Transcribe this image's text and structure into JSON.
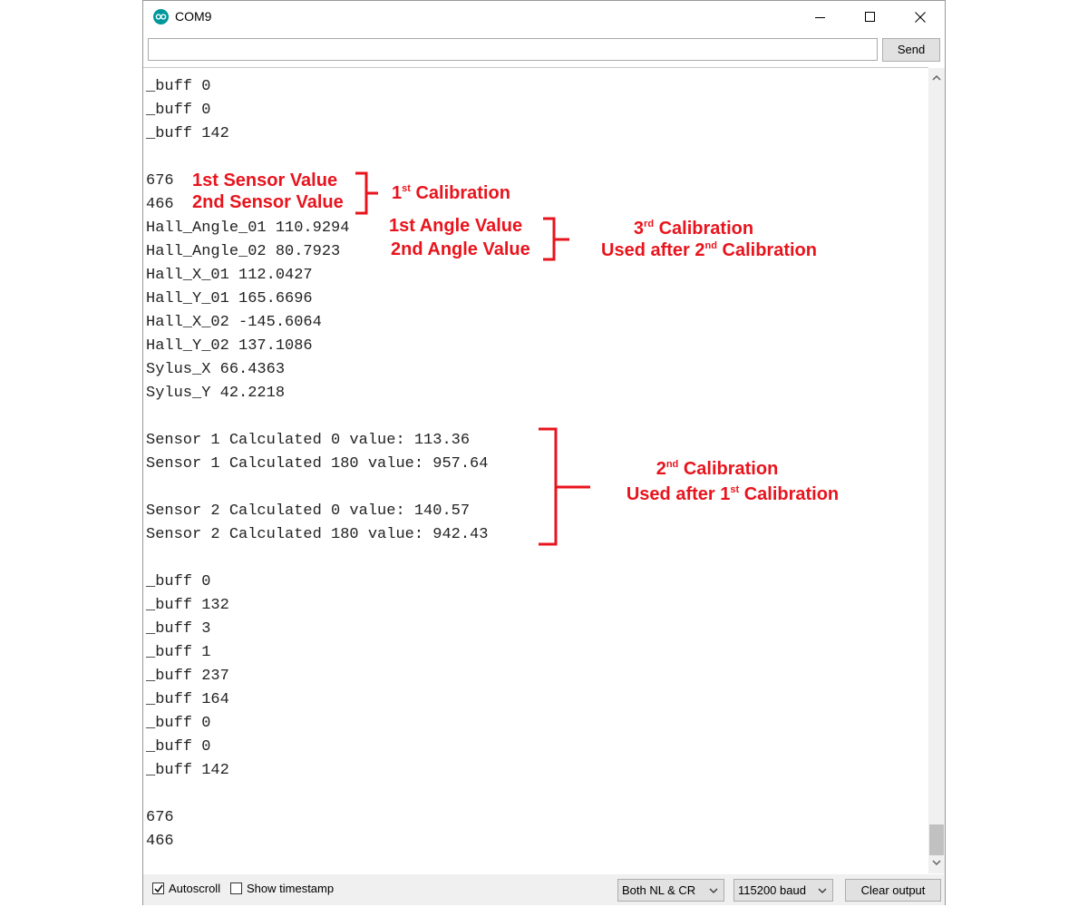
{
  "window": {
    "title": "COM9",
    "send_label": "Send",
    "send_input_value": ""
  },
  "output_lines": [
    "_buff 0",
    "_buff 0",
    "_buff 142",
    "",
    "676",
    "466",
    "Hall_Angle_01 110.9294",
    "Hall_Angle_02 80.7923",
    "Hall_X_01 112.0427",
    "Hall_Y_01 165.6696",
    "Hall_X_02 -145.6064",
    "Hall_Y_02 137.1086",
    "Sylus_X 66.4363",
    "Sylus_Y 42.2218",
    "",
    "Sensor 1 Calculated 0 value: 113.36",
    "Sensor 1 Calculated 180 value: 957.64",
    "",
    "Sensor 2 Calculated 0 value: 140.57",
    "Sensor 2 Calculated 180 value: 942.43",
    "",
    "_buff 0",
    "_buff 132",
    "_buff 3",
    "_buff 1",
    "_buff 237",
    "_buff 164",
    "_buff 0",
    "_buff 0",
    "_buff 142",
    "",
    "676",
    "466"
  ],
  "status": {
    "autoscroll_label": "Autoscroll",
    "autoscroll_checked": true,
    "timestamp_label": "Show timestamp",
    "timestamp_checked": false,
    "line_ending": "Both NL & CR",
    "baud": "115200 baud",
    "clear_label": "Clear output"
  },
  "annotations": {
    "color": "#e8141d",
    "sensor1": "1st Sensor Value",
    "sensor2": "2nd Sensor Value",
    "cal1": {
      "num": "1",
      "sup": "st",
      "word": "Calibration"
    },
    "angle1": "1st Angle Value",
    "angle2": "2nd Angle Value",
    "cal3": {
      "num": "3",
      "sup": "rd",
      "word": "Calibration"
    },
    "cal3_sub": {
      "pre": "Used after 2",
      "sup": "nd",
      "word": "Calibration"
    },
    "cal2": {
      "num": "2",
      "sup": "nd",
      "word": "Calibration"
    },
    "cal2_sub": {
      "pre": "Used after 1",
      "sup": "st",
      "word": "Calibration"
    }
  },
  "icons": {
    "app": "arduino-icon",
    "minimize": "minimize-icon",
    "maximize": "maximize-icon",
    "close": "close-icon",
    "scroll_up": "chevron-up-icon",
    "scroll_down": "chevron-down-icon",
    "dropdown": "chevron-down-icon",
    "check": "check-icon"
  }
}
